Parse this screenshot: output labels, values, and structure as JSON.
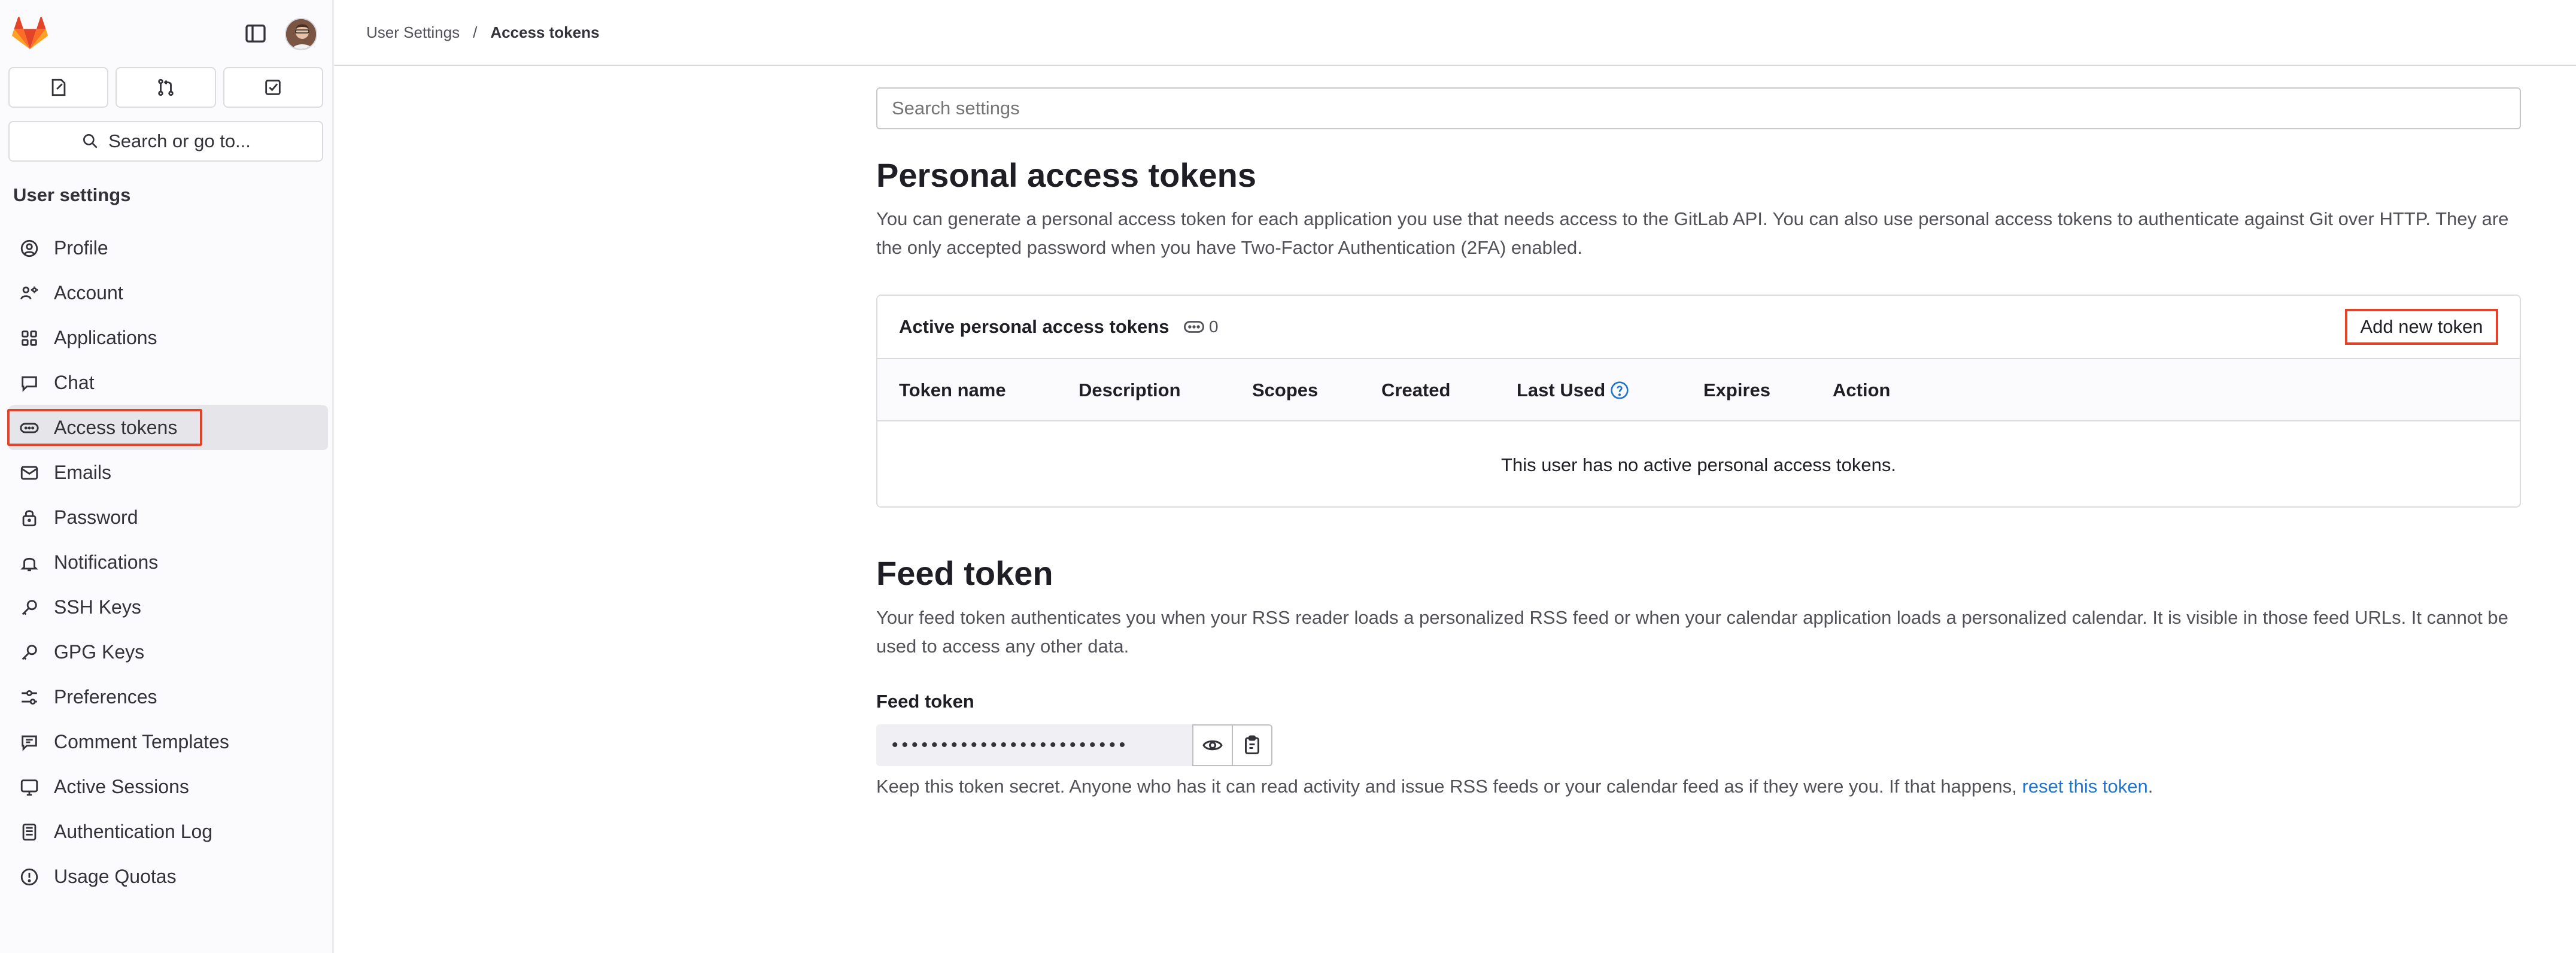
{
  "colors": {
    "accent": "#e24329",
    "link": "#1f75cb",
    "active_bg": "#e6e5ea"
  },
  "sidebar": {
    "quick_actions": [
      {
        "icon": "issues-icon"
      },
      {
        "icon": "merge-request-icon"
      },
      {
        "icon": "todo-icon"
      }
    ],
    "search_label": "Search or go to...",
    "heading": "User settings",
    "items": [
      {
        "label": "Profile",
        "icon": "profile-icon"
      },
      {
        "label": "Account",
        "icon": "account-icon"
      },
      {
        "label": "Applications",
        "icon": "applications-icon"
      },
      {
        "label": "Chat",
        "icon": "chat-icon"
      },
      {
        "label": "Access tokens",
        "icon": "token-icon",
        "active": true
      },
      {
        "label": "Emails",
        "icon": "mail-icon"
      },
      {
        "label": "Password",
        "icon": "lock-icon"
      },
      {
        "label": "Notifications",
        "icon": "bell-icon"
      },
      {
        "label": "SSH Keys",
        "icon": "key-icon"
      },
      {
        "label": "GPG Keys",
        "icon": "key-icon"
      },
      {
        "label": "Preferences",
        "icon": "preferences-icon"
      },
      {
        "label": "Comment Templates",
        "icon": "comment-icon"
      },
      {
        "label": "Active Sessions",
        "icon": "monitor-icon"
      },
      {
        "label": "Authentication Log",
        "icon": "log-icon"
      },
      {
        "label": "Usage Quotas",
        "icon": "quota-icon"
      }
    ]
  },
  "breadcrumb": {
    "parent": "User Settings",
    "separator": "/",
    "current": "Access tokens"
  },
  "main": {
    "search_placeholder": "Search settings",
    "title": "Personal access tokens",
    "description": "You can generate a personal access token for each application you use that needs access to the GitLab API. You can also use personal access tokens to authenticate against Git over HTTP. They are the only accepted password when you have Two-Factor Authentication (2FA) enabled.",
    "tokens_card": {
      "title": "Active personal access tokens",
      "count": "0",
      "add_button": "Add new token",
      "columns": [
        "Token name",
        "Description",
        "Scopes",
        "Created",
        "Last Used",
        "Expires",
        "Action"
      ],
      "empty_message": "This user has no active personal access tokens."
    },
    "feed": {
      "title": "Feed token",
      "description": "Your feed token authenticates you when your RSS reader loads a personalized RSS feed or when your calendar application loads a personalized calendar. It is visible in those feed URLs. It cannot be used to access any other data.",
      "label": "Feed token",
      "masked_value": "••••••••••••••••••••••••",
      "help_prefix": "Keep this token secret. Anyone who has it can read activity and issue RSS feeds or your calendar feed as if they were you. If that happens, ",
      "help_link": "reset this token",
      "help_suffix": "."
    }
  }
}
